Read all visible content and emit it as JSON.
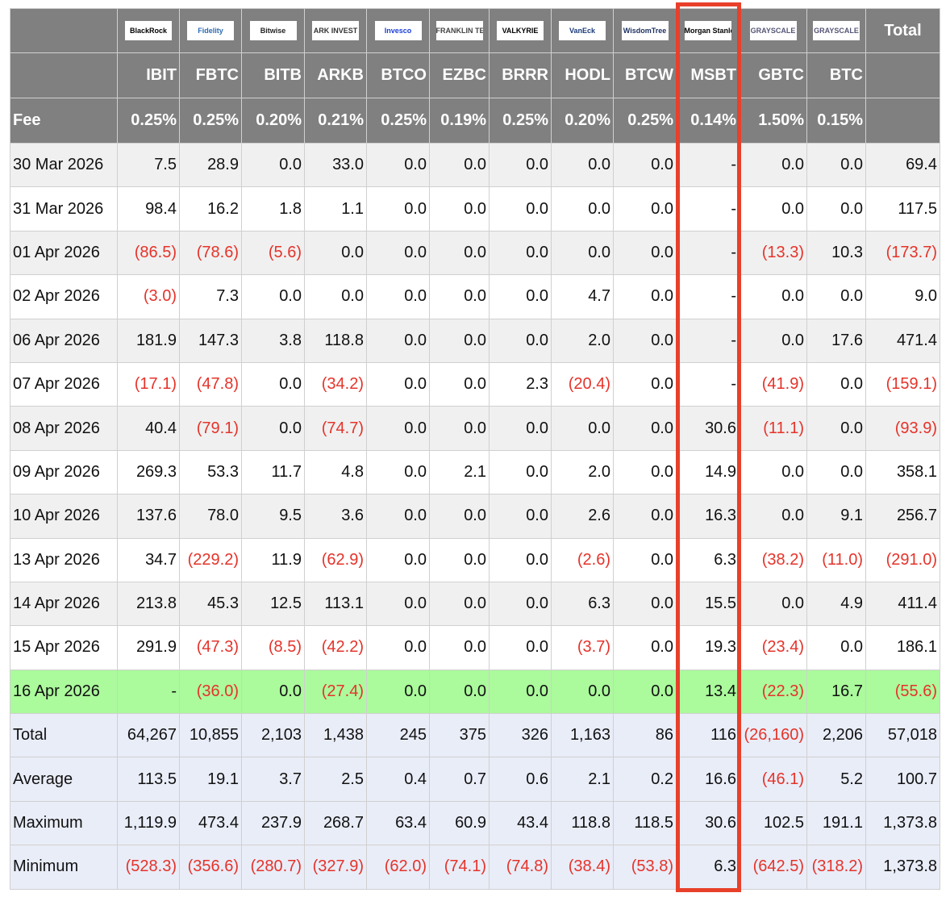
{
  "columns": [
    {
      "issuer": "BlackRock",
      "ticker": "IBIT",
      "fee": "0.25%",
      "logo_color": "#000000"
    },
    {
      "issuer": "Fidelity",
      "ticker": "FBTC",
      "fee": "0.25%",
      "logo_color": "#2a6bb1"
    },
    {
      "issuer": "Bitwise",
      "ticker": "BITB",
      "fee": "0.20%",
      "logo_color": "#222222"
    },
    {
      "issuer": "ARK INVEST",
      "ticker": "ARKB",
      "fee": "0.21%",
      "logo_color": "#333333"
    },
    {
      "issuer": "Invesco",
      "ticker": "BTCO",
      "fee": "0.25%",
      "logo_color": "#1a3fd6"
    },
    {
      "issuer": "FRANKLIN TEMPLETON",
      "ticker": "EZBC",
      "fee": "0.19%",
      "logo_color": "#444444"
    },
    {
      "issuer": "VALKYRIE",
      "ticker": "BRRR",
      "fee": "0.25%",
      "logo_color": "#000000"
    },
    {
      "issuer": "VanEck",
      "ticker": "HODL",
      "fee": "0.20%",
      "logo_color": "#1b3b7a"
    },
    {
      "issuer": "WisdomTree",
      "ticker": "BTCW",
      "fee": "0.25%",
      "logo_color": "#1b2f5e"
    },
    {
      "issuer": "Morgan Stanley",
      "ticker": "MSBT",
      "fee": "0.14%",
      "logo_color": "#000000"
    },
    {
      "issuer": "GRAYSCALE",
      "ticker": "GBTC",
      "fee": "1.50%",
      "logo_color": "#555577"
    },
    {
      "issuer": "GRAYSCALE",
      "ticker": "BTC",
      "fee": "0.15%",
      "logo_color": "#555577"
    }
  ],
  "total_header": "Total",
  "fee_label": "Fee",
  "rows": [
    {
      "date": "30 Mar 2026",
      "values": [
        "7.5",
        "28.9",
        "0.0",
        "33.0",
        "0.0",
        "0.0",
        "0.0",
        "0.0",
        "0.0",
        "-",
        "0.0",
        "0.0",
        "69.4"
      ]
    },
    {
      "date": "31 Mar 2026",
      "values": [
        "98.4",
        "16.2",
        "1.8",
        "1.1",
        "0.0",
        "0.0",
        "0.0",
        "0.0",
        "0.0",
        "-",
        "0.0",
        "0.0",
        "117.5"
      ]
    },
    {
      "date": "01 Apr 2026",
      "values": [
        "(86.5)",
        "(78.6)",
        "(5.6)",
        "0.0",
        "0.0",
        "0.0",
        "0.0",
        "0.0",
        "0.0",
        "-",
        "(13.3)",
        "10.3",
        "(173.7)"
      ]
    },
    {
      "date": "02 Apr 2026",
      "values": [
        "(3.0)",
        "7.3",
        "0.0",
        "0.0",
        "0.0",
        "0.0",
        "0.0",
        "4.7",
        "0.0",
        "-",
        "0.0",
        "0.0",
        "9.0"
      ]
    },
    {
      "date": "06 Apr 2026",
      "values": [
        "181.9",
        "147.3",
        "3.8",
        "118.8",
        "0.0",
        "0.0",
        "0.0",
        "2.0",
        "0.0",
        "-",
        "0.0",
        "17.6",
        "471.4"
      ]
    },
    {
      "date": "07 Apr 2026",
      "values": [
        "(17.1)",
        "(47.8)",
        "0.0",
        "(34.2)",
        "0.0",
        "0.0",
        "2.3",
        "(20.4)",
        "0.0",
        "-",
        "(41.9)",
        "0.0",
        "(159.1)"
      ]
    },
    {
      "date": "08 Apr 2026",
      "values": [
        "40.4",
        "(79.1)",
        "0.0",
        "(74.7)",
        "0.0",
        "0.0",
        "0.0",
        "0.0",
        "0.0",
        "30.6",
        "(11.1)",
        "0.0",
        "(93.9)"
      ]
    },
    {
      "date": "09 Apr 2026",
      "values": [
        "269.3",
        "53.3",
        "11.7",
        "4.8",
        "0.0",
        "2.1",
        "0.0",
        "2.0",
        "0.0",
        "14.9",
        "0.0",
        "0.0",
        "358.1"
      ]
    },
    {
      "date": "10 Apr 2026",
      "values": [
        "137.6",
        "78.0",
        "9.5",
        "3.6",
        "0.0",
        "0.0",
        "0.0",
        "2.6",
        "0.0",
        "16.3",
        "0.0",
        "9.1",
        "256.7"
      ]
    },
    {
      "date": "13 Apr 2026",
      "values": [
        "34.7",
        "(229.2)",
        "11.9",
        "(62.9)",
        "0.0",
        "0.0",
        "0.0",
        "(2.6)",
        "0.0",
        "6.3",
        "(38.2)",
        "(11.0)",
        "(291.0)"
      ]
    },
    {
      "date": "14 Apr 2026",
      "values": [
        "213.8",
        "45.3",
        "12.5",
        "113.1",
        "0.0",
        "0.0",
        "0.0",
        "6.3",
        "0.0",
        "15.5",
        "0.0",
        "4.9",
        "411.4"
      ]
    },
    {
      "date": "15 Apr 2026",
      "values": [
        "291.9",
        "(47.3)",
        "(8.5)",
        "(42.2)",
        "0.0",
        "0.0",
        "0.0",
        "(3.7)",
        "0.0",
        "19.3",
        "(23.4)",
        "0.0",
        "186.1"
      ]
    },
    {
      "date": "16 Apr 2026",
      "highlight": true,
      "values": [
        "-",
        "(36.0)",
        "0.0",
        "(27.4)",
        "0.0",
        "0.0",
        "0.0",
        "0.0",
        "0.0",
        "13.4",
        "(22.3)",
        "16.7",
        "(55.6)"
      ]
    }
  ],
  "summary": [
    {
      "label": "Total",
      "values": [
        "64,267",
        "10,855",
        "2,103",
        "1,438",
        "245",
        "375",
        "326",
        "1,163",
        "86",
        "116",
        "(26,160)",
        "2,206",
        "57,018"
      ]
    },
    {
      "label": "Average",
      "values": [
        "113.5",
        "19.1",
        "3.7",
        "2.5",
        "0.4",
        "0.7",
        "0.6",
        "2.1",
        "0.2",
        "16.6",
        "(46.1)",
        "5.2",
        "100.7"
      ]
    },
    {
      "label": "Maximum",
      "values": [
        "1,119.9",
        "473.4",
        "237.9",
        "268.7",
        "63.4",
        "60.9",
        "43.4",
        "118.8",
        "118.5",
        "30.6",
        "102.5",
        "191.1",
        "1,373.8"
      ]
    },
    {
      "label": "Minimum",
      "values": [
        "(528.3)",
        "(356.6)",
        "(280.7)",
        "(327.9)",
        "(62.0)",
        "(74.1)",
        "(74.8)",
        "(38.4)",
        "(53.8)",
        "6.3",
        "(642.5)",
        "(318.2)",
        "1,373.8"
      ]
    }
  ],
  "colors": {
    "header": "#808080",
    "negative": "#e5332a",
    "highlight_row": "#abfa9c",
    "summary_row": "#e9edf8",
    "callout": "#e8402a"
  }
}
